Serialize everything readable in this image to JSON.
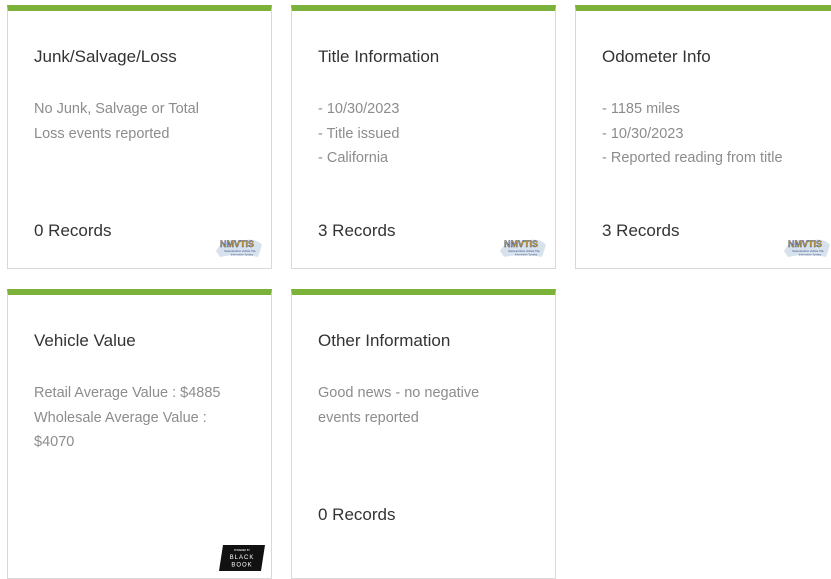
{
  "cards": [
    {
      "title": "Junk/Salvage/Loss",
      "lines": [
        "No Junk, Salvage or Total Loss events reported"
      ],
      "records": "0 Records",
      "logo": "NMVTIS"
    },
    {
      "title": "Title Information",
      "lines": [
        "- 10/30/2023",
        "- Title issued",
        "- California"
      ],
      "records": "3 Records",
      "logo": "NMVTIS"
    },
    {
      "title": "Odometer Info",
      "lines": [
        "- 1185 miles",
        "- 10/30/2023",
        "- Reported reading from title"
      ],
      "records": "3 Records",
      "logo": "NMVTIS"
    },
    {
      "title": "Vehicle Value",
      "lines": [
        "Retail Average Value : $4885",
        "Wholesale Average Value : $4070"
      ],
      "logo_top": "POWERED BY",
      "logo_l1": "BLACK",
      "logo_l2": "BOOK"
    },
    {
      "title": "Other Information",
      "lines": [
        "Good news - no negative events reported"
      ],
      "records": "0 Records"
    }
  ],
  "nmvtis_logo": {
    "name": "NMVTIS",
    "subtitle_1": "National Motor Vehicle Title",
    "subtitle_2": "Information System"
  },
  "colors": {
    "accent": "#7cb23a",
    "title": "#333333",
    "body": "#8c8c8c",
    "border": "#d9d9d9"
  }
}
